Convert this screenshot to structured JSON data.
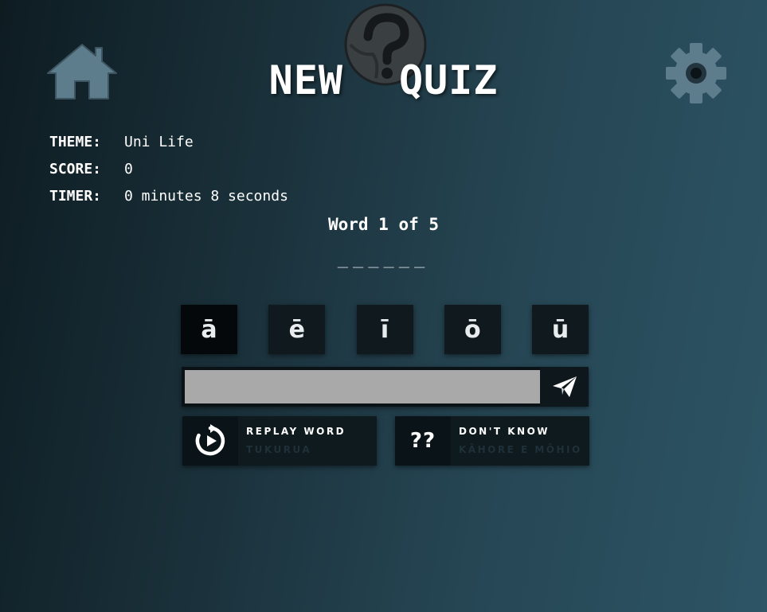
{
  "header": {
    "title_part1": "NEW",
    "title_part2": "QUIZ",
    "home_icon": "home-icon",
    "settings_icon": "gear-icon",
    "logo_icon": "question-ball-icon"
  },
  "info": {
    "theme_label": "THEME:",
    "theme_value": "Uni Life",
    "score_label": "SCORE:",
    "score_value": "0",
    "timer_label": "TIMER:",
    "timer_value": "0 minutes 8 seconds"
  },
  "quiz": {
    "progress": "Word 1 of 5",
    "blanks": "______"
  },
  "vowels": [
    "ā",
    "ē",
    "ī",
    "ō",
    "ū"
  ],
  "answer": {
    "value": "",
    "placeholder": "",
    "submit_icon": "paper-plane-icon"
  },
  "actions": {
    "replay_label": "REPLAY WORD",
    "replay_sub": "TUKURUA",
    "replay_icon": "replay-icon",
    "dontknow_label": "DON'T KNOW",
    "dontknow_sub": "KĀHORE E MŌHIO",
    "dontknow_icon_text": "??"
  },
  "colors": {
    "background_dark": "#0e1c22",
    "background_light": "#2d5565",
    "icon_slate": "#5e7d8c",
    "button_dark": "#0f191e",
    "input_gray": "#a9a9a9"
  }
}
